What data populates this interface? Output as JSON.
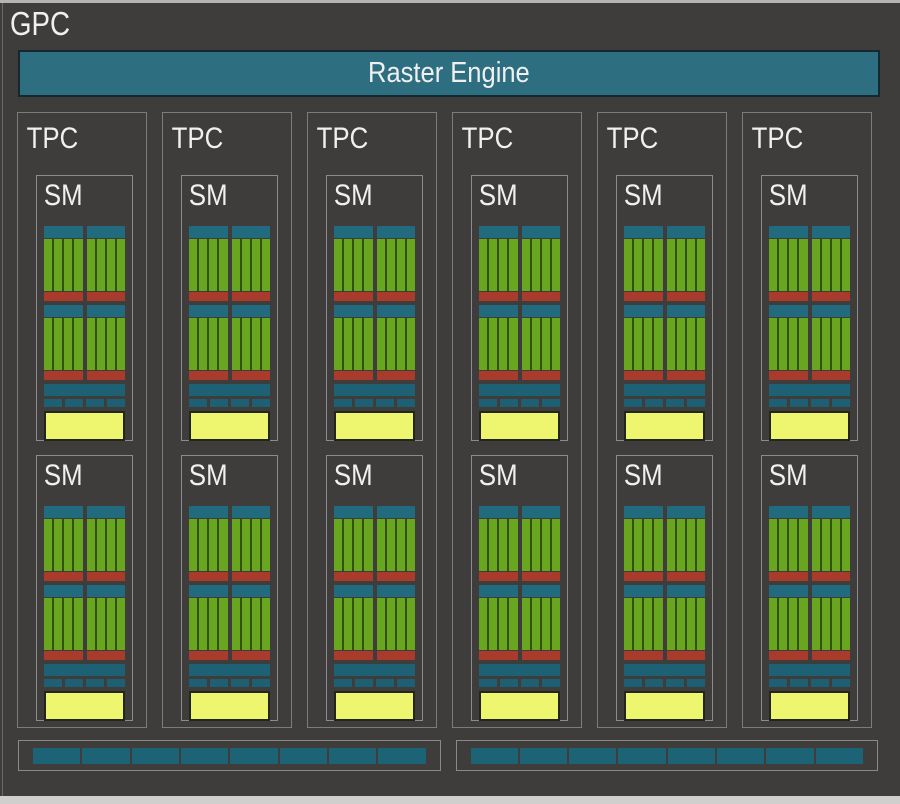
{
  "labels": {
    "gpc": "GPC",
    "raster_engine": "Raster Engine",
    "tpc": "TPC",
    "sm": "SM"
  },
  "structure": {
    "tpc_count": 6,
    "sms_per_tpc": 2,
    "processing_blocks_per_sm": 2,
    "partitions_per_block": 2,
    "core_stripes_per_partition": 4,
    "ldst_segments_per_sm": 4,
    "bottom_bar_count": 2,
    "segments_per_bottom_bar": 8
  },
  "colors": {
    "bg-dark": "#3e3d3b",
    "frame-light": "#b5b4b2",
    "frame-bottom": "#d0cfcd",
    "gpc-edge": "#6b6a68",
    "raster-teal": "#2d6e81",
    "raster-border": "#142830",
    "tpc-border": "#7d7c7a",
    "sm-border": "#8b8a8e",
    "label-text": "#f0f0f0",
    "scheduler-teal": "#226a7e",
    "core-green": "#68a61f",
    "core-divider": "#33510d",
    "dispatch-red": "#a83b2b",
    "l1-teal": "#1e6175",
    "ldst-teal": "#1d6073",
    "tex-yellow": "#eef56e",
    "tex-border": "#23261c",
    "bottom-teal": "#1d6376",
    "bottom-border": "#8a8988"
  }
}
